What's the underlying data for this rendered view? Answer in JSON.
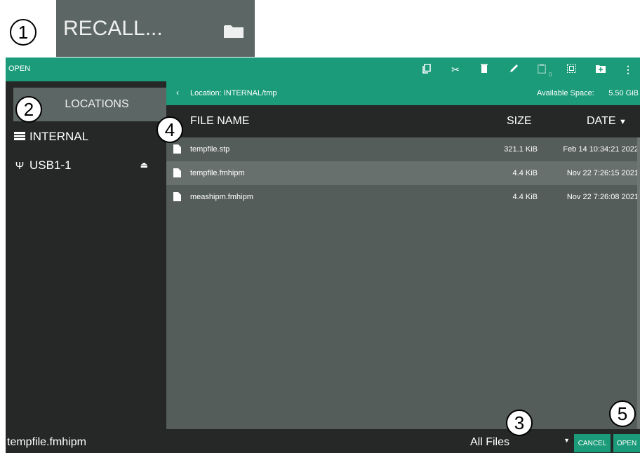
{
  "callouts": [
    "1",
    "2",
    "3",
    "4",
    "5"
  ],
  "recall_button": {
    "label": "RECALL...",
    "icon": "folder-icon"
  },
  "titlebar": {
    "title": "OPEN",
    "toolbar": [
      {
        "name": "copy-icon",
        "glyph": "⧉"
      },
      {
        "name": "cut-icon",
        "glyph": "✂"
      },
      {
        "name": "delete-icon",
        "glyph": "🗑"
      },
      {
        "name": "rename-icon",
        "glyph": "✎"
      },
      {
        "name": "paste-icon",
        "glyph": "📋"
      },
      {
        "name": "select-all-icon",
        "glyph": "⊡"
      },
      {
        "name": "new-folder-icon",
        "glyph": "⊞"
      },
      {
        "name": "more-icon",
        "glyph": "⋮"
      }
    ],
    "paste_count": "0"
  },
  "sidebar": {
    "header": "LOCATIONS",
    "items": [
      {
        "label": "INTERNAL",
        "icon": "storage-icon"
      },
      {
        "label": "USB1-1",
        "icon": "usb-icon",
        "eject": "eject-icon"
      }
    ]
  },
  "location_bar": {
    "path": "Location: INTERNAL/tmp",
    "available_label": "Available Space:",
    "available_value": "5.50 GiB"
  },
  "columns": {
    "name": "FILE NAME",
    "size": "SIZE",
    "date": "DATE"
  },
  "files": [
    {
      "name": "tempfile.stp",
      "size": "321.1 KiB",
      "date": "Feb 14 10:34:21 2022",
      "selected": false
    },
    {
      "name": "tempfile.fmhipm",
      "size": "4.4 KiB",
      "date": "Nov 22 7:26:15 2021",
      "selected": true
    },
    {
      "name": "meashipm.fmhipm",
      "size": "4.4 KiB",
      "date": "Nov 22 7:26:08 2021",
      "selected": false
    }
  ],
  "bottom": {
    "filename": "tempfile.fmhipm",
    "filter": "All Files",
    "cancel_label": "CANCEL",
    "open_label": "OPEN"
  },
  "colors": {
    "accent": "#1b9b7a",
    "panel": "#555d5b",
    "dark": "#262828",
    "selected_row": "#68706e"
  }
}
